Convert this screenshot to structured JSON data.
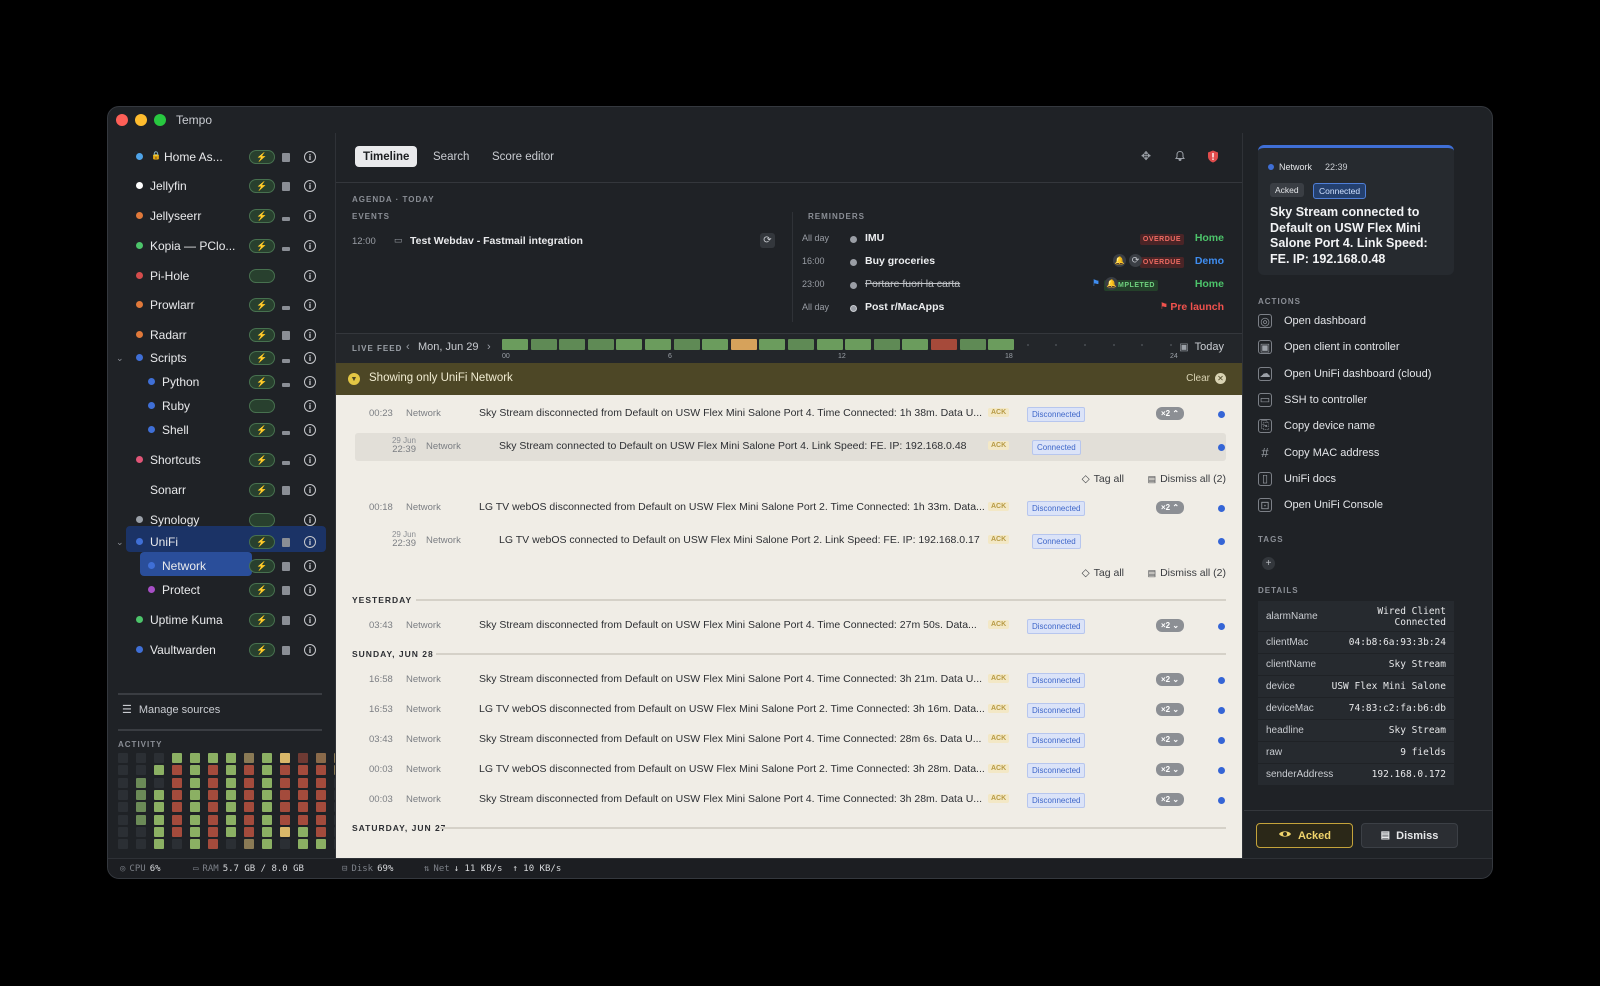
{
  "window": {
    "title": "Tempo"
  },
  "sidebar": {
    "sources": [
      {
        "label": "Home As...",
        "color": "#4ea3e8",
        "locked": true
      },
      {
        "label": "Jellyfin",
        "color": "#ffffff"
      },
      {
        "label": "Jellyseerr",
        "color": "#e0793a"
      },
      {
        "label": "Kopia — PClo...",
        "color": "#4cc46a"
      },
      {
        "label": "Pi-Hole",
        "color": "#d44c4c"
      },
      {
        "label": "Prowlarr",
        "color": "#e0793a"
      },
      {
        "label": "Radarr",
        "color": "#e0793a"
      },
      {
        "label": "Scripts",
        "color": "#3f6fd6"
      },
      {
        "label": "Python",
        "color": "#3f6fd6"
      },
      {
        "label": "Ruby",
        "color": "#3f6fd6"
      },
      {
        "label": "Shell",
        "color": "#3f6fd6"
      },
      {
        "label": "Shortcuts",
        "color": "#e05577"
      },
      {
        "label": "Sonarr",
        "color": ""
      },
      {
        "label": "Synology",
        "color": "#9aa0a8"
      },
      {
        "label": "UniFi",
        "color": "#3f6fd6"
      },
      {
        "label": "Network",
        "color": "#3f6fd6"
      },
      {
        "label": "Protect",
        "color": "#a74fc6"
      },
      {
        "label": "Uptime Kuma",
        "color": "#4cc46a"
      },
      {
        "label": "Vaultwarden",
        "color": "#3f6fd6"
      }
    ],
    "manage_sources": "Manage sources",
    "activity_label": "ACTIVITY"
  },
  "statusbar": {
    "cpu_label": "CPU",
    "cpu": "6%",
    "ram_label": "RAM",
    "ram": "5.7 GB / 8.0 GB",
    "disk_label": "Disk",
    "disk": "69%",
    "net_label": "Net",
    "net_down": "↓ 11 KB/s",
    "net_up": "↑ 10 KB/s"
  },
  "toolbar": {
    "tabs": [
      "Timeline",
      "Search",
      "Score editor"
    ],
    "active_tab": "Timeline"
  },
  "agenda": {
    "title": "AGENDA · TODAY",
    "events_label": "EVENTS",
    "reminders_label": "REMINDERS",
    "events": [
      {
        "time": "12:00",
        "title": "Test Webdav - Fastmail integration"
      }
    ],
    "reminders": [
      {
        "time": "All day",
        "title": "IMU",
        "badge": "OVERDUE",
        "list": "Home",
        "list_color": "#4cc46a"
      },
      {
        "time": "16:00",
        "title": "Buy groceries",
        "badge": "OVERDUE",
        "list": "Demo",
        "list_color": "#3f8df0"
      },
      {
        "time": "23:00",
        "title": "Portare fuori la carta",
        "badge": "COMPLETED",
        "list": "Home",
        "list_color": "#4cc46a"
      },
      {
        "time": "All day",
        "title": "Post r/MacApps",
        "badge": "",
        "list": "Pre launch",
        "list_color": "#f0524d"
      }
    ]
  },
  "livefeed": {
    "label": "LIVE FEED",
    "day": "Mon, Jun 29",
    "today": "Today",
    "ticks": [
      "00",
      "6",
      "12",
      "18",
      "24"
    ]
  },
  "filter": {
    "text": "Showing only UniFi Network",
    "clear": "Clear"
  },
  "feed": {
    "ack": "ACK",
    "tag_all": "Tag all",
    "dismiss_all": "Dismiss all (2)",
    "today_rows": [
      {
        "time": "00:23",
        "cat": "Network",
        "msg": "Sky Stream disconnected from Default on USW Flex Mini Salone Port 4. Time Connected: 1h 38m. Data U...",
        "status": "Disconnected",
        "count": "×2 ⌃"
      },
      {
        "date": "29 Jun",
        "time": "22:39",
        "cat": "Network",
        "msg": "Sky Stream connected to Default on USW Flex Mini Salone Port 4. Link Speed: FE. IP: 192.168.0.48",
        "status": "Connected"
      },
      {
        "time": "00:18",
        "cat": "Network",
        "msg": "LG TV webOS disconnected from Default on USW Flex Mini Salone Port 2. Time Connected: 1h 33m. Data...",
        "status": "Disconnected",
        "count": "×2 ⌃"
      },
      {
        "date": "29 Jun",
        "time": "22:39",
        "cat": "Network",
        "msg": "LG TV webOS connected to Default on USW Flex Mini Salone Port 2. Link Speed: FE. IP: 192.168.0.17",
        "status": "Connected"
      }
    ],
    "yesterday_label": "YESTERDAY",
    "yesterday_rows": [
      {
        "time": "03:43",
        "cat": "Network",
        "msg": "Sky Stream disconnected from Default on USW Flex Mini Salone Port 4. Time Connected: 27m 50s. Data...",
        "status": "Disconnected",
        "count": "×2 ⌄"
      }
    ],
    "sunday_label": "SUNDAY, JUN 28",
    "sunday_rows": [
      {
        "time": "16:58",
        "cat": "Network",
        "msg": "Sky Stream disconnected from Default on USW Flex Mini Salone Port 4. Time Connected: 3h 21m. Data U...",
        "status": "Disconnected",
        "count": "×2 ⌄"
      },
      {
        "time": "16:53",
        "cat": "Network",
        "msg": "LG TV webOS disconnected from Default on USW Flex Mini Salone Port 2. Time Connected: 3h 16m. Data...",
        "status": "Disconnected",
        "count": "×2 ⌄"
      },
      {
        "time": "03:43",
        "cat": "Network",
        "msg": "Sky Stream disconnected from Default on USW Flex Mini Salone Port 4. Time Connected: 28m 6s. Data U...",
        "status": "Disconnected",
        "count": "×2 ⌄"
      },
      {
        "time": "00:03",
        "cat": "Network",
        "msg": "LG TV webOS disconnected from Default on USW Flex Mini Salone Port 2. Time Connected: 3h 28m. Data...",
        "status": "Disconnected",
        "count": "×2 ⌄"
      },
      {
        "time": "00:03",
        "cat": "Network",
        "msg": "Sky Stream disconnected from Default on USW Flex Mini Salone Port 4. Time Connected: 3h 28m. Data U...",
        "status": "Disconnected",
        "count": "×2 ⌄"
      }
    ],
    "saturday_label": "SATURDAY, JUN 27"
  },
  "detail": {
    "source": "Network",
    "time": "22:39",
    "pill_acked": "Acked",
    "pill_connected": "Connected",
    "headline": "Sky Stream connected to Default on USW Flex Mini Salone Port 4. Link Speed: FE. IP: 192.168.0.48",
    "actions_label": "ACTIONS",
    "actions": [
      "Open dashboard",
      "Open client in controller",
      "Open UniFi dashboard (cloud)",
      "SSH to controller",
      "Copy device name",
      "Copy MAC address",
      "UniFi docs",
      "Open UniFi Console"
    ],
    "tags_label": "TAGS",
    "details_label": "DETAILS",
    "details": [
      {
        "k": "alarmName",
        "v": "Wired Client\nConnected"
      },
      {
        "k": "clientMac",
        "v": "04:b8:6a:93:3b:24"
      },
      {
        "k": "clientName",
        "v": "Sky Stream"
      },
      {
        "k": "device",
        "v": "USW Flex Mini Salone"
      },
      {
        "k": "deviceMac",
        "v": "74:83:c2:fa:b6:db"
      },
      {
        "k": "headline",
        "v": "Sky Stream"
      },
      {
        "k": "raw",
        "v": "9 fields"
      },
      {
        "k": "senderAddress",
        "v": "192.168.0.172"
      }
    ],
    "acked_button": "Acked",
    "dismiss_button": "Dismiss"
  },
  "colors": {
    "accent": "#3f6fd6",
    "ack_yellow": "#e4c744",
    "overdue": "#e04c4c",
    "completed": "#4cc46a"
  }
}
